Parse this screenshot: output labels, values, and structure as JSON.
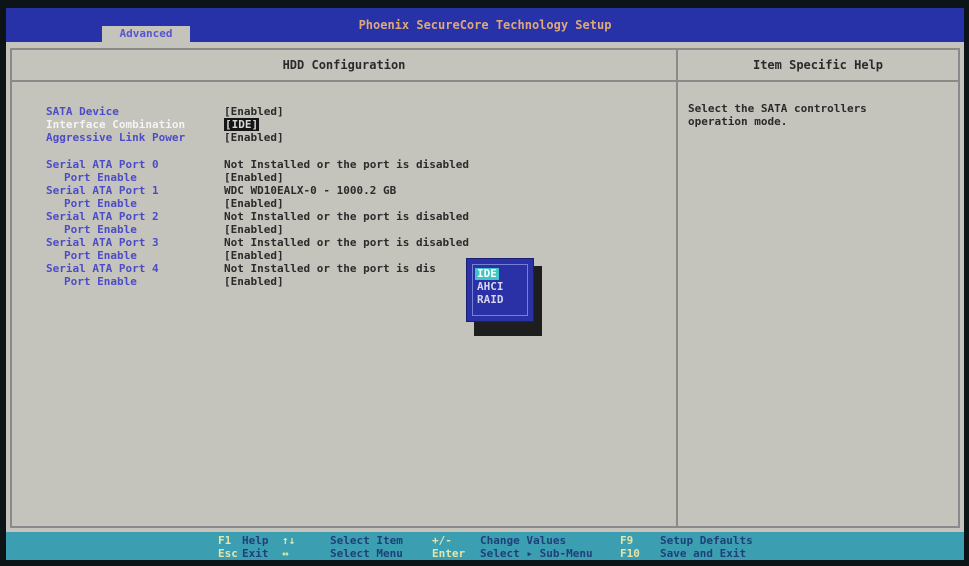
{
  "header": {
    "title": "Phoenix SecureCore Technology Setup",
    "active_tab": "Advanced"
  },
  "panel": {
    "title": "HDD Configuration",
    "help_title": "Item Specific Help",
    "help_text_1": "Select the SATA controllers",
    "help_text_2": "operation mode."
  },
  "settings": [
    {
      "label": "SATA Device",
      "value": "[Enabled]"
    },
    {
      "label": "Interface Combination",
      "value": "[IDE]",
      "selected": true
    },
    {
      "label": "Aggressive Link Power",
      "value": "[Enabled]"
    },
    {
      "label": "Serial ATA Port 0",
      "value": "Not Installed or the port is disabled"
    },
    {
      "label": "Port Enable",
      "value": "[Enabled]"
    },
    {
      "label": "Serial ATA Port 1",
      "value": "WDC WD10EALX-0 - 1000.2 GB"
    },
    {
      "label": "Port Enable",
      "value": "[Enabled]"
    },
    {
      "label": "Serial ATA Port 2",
      "value": "Not Installed or the port is disabled"
    },
    {
      "label": "Port Enable",
      "value": "[Enabled]"
    },
    {
      "label": "Serial ATA Port 3",
      "value": "Not Installed or the port is disabled"
    },
    {
      "label": "Port Enable",
      "value": "[Enabled]"
    },
    {
      "label": "Serial ATA Port 4",
      "value": "Not Installed or the port is dis"
    },
    {
      "label": "Port Enable",
      "value": "[Enabled]"
    }
  ],
  "popup": {
    "options": [
      "IDE",
      "AHCI",
      "RAID"
    ],
    "selected": "IDE"
  },
  "footer": {
    "f1_key": "F1",
    "f1_desc": "Help",
    "esc_key": "Esc",
    "esc_desc": "Exit",
    "updown_key": "↑↓",
    "updown_desc": "Select Item",
    "leftright_key": "↔",
    "leftright_desc": "Select Menu",
    "plusminus_key": "+/-",
    "plusminus_desc": "Change Values",
    "enter_key": "Enter",
    "enter_desc": "Select ▸ Sub-Menu",
    "f9_key": "F9",
    "f9_desc": "Setup Defaults",
    "f10_key": "F10",
    "f10_desc": "Save and Exit"
  },
  "colors": {
    "menu_blue": "#2731a8",
    "bios_gray": "#c4c3bc",
    "footer_cyan": "#3c9fb1",
    "label_blue": "#4c4cc6"
  }
}
